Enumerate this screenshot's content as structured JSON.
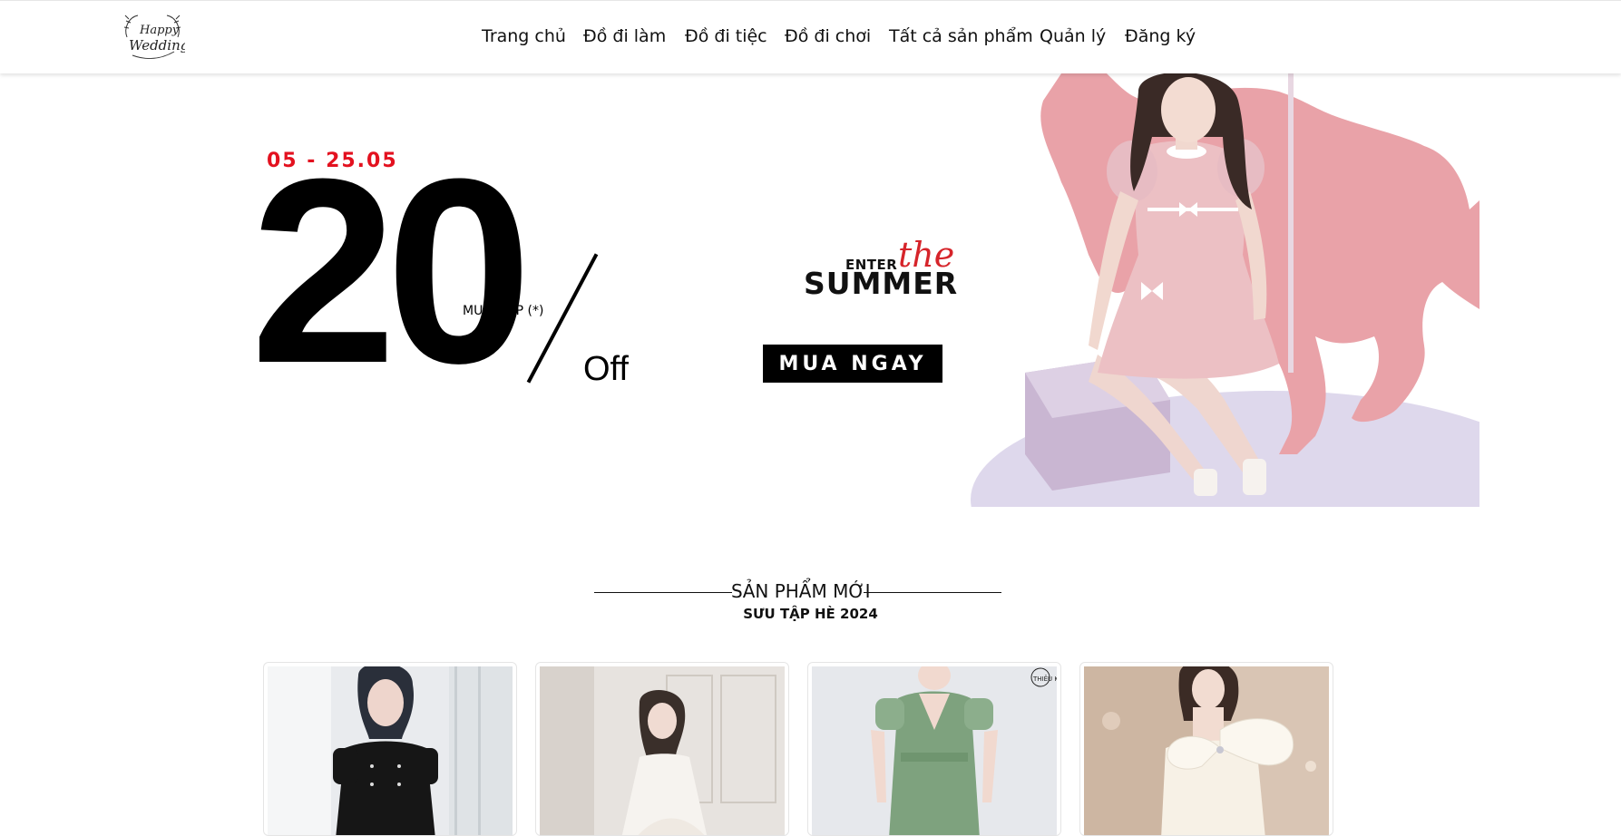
{
  "nav": {
    "logo": "Happy Wedding",
    "items": [
      {
        "label": "Trang chủ"
      },
      {
        "label": "Đồ đi làm"
      },
      {
        "label": "Đồ đi tiệc"
      },
      {
        "label": "Đồ đi chơi"
      },
      {
        "label": "Tất cả sản phẩm"
      },
      {
        "label": "Quản lý"
      },
      {
        "label": "Đăng ký"
      }
    ]
  },
  "hero": {
    "date": "05 - 25.05",
    "discount": "20",
    "off": "Off",
    "note": "MUA 2 SP (*)",
    "enter": "ENTER",
    "the": "the",
    "summer": "SUMMER",
    "cta": "MUA NGAY",
    "accent_color": "#e3111f",
    "horse_color": "#e9a2a8"
  },
  "products": {
    "title": "SẢN PHẨM MỚI",
    "subtitle": "SƯU TẬP HÈ 2024",
    "cards": [
      {
        "dress": "black"
      },
      {
        "dress": "white"
      },
      {
        "dress": "green",
        "watermark": "THIÊU K"
      },
      {
        "dress": "ivory"
      }
    ]
  }
}
